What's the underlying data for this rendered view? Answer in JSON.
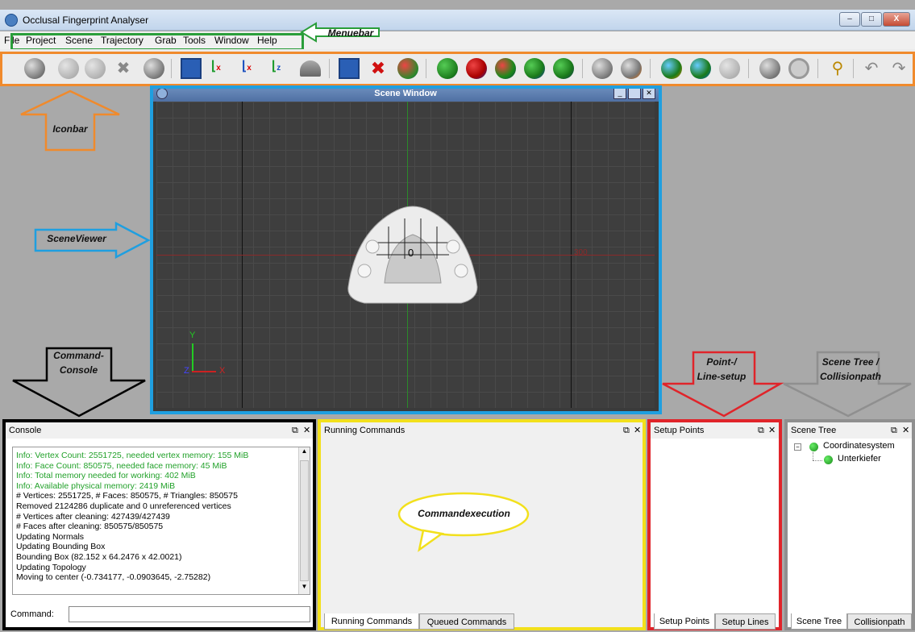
{
  "window": {
    "title": "Occlusal Fingerprint Analyser",
    "min": "–",
    "max": "□",
    "close": "X"
  },
  "menu": [
    "File",
    "Project",
    "Scene",
    "Trajectory",
    "Grab",
    "Tools",
    "Window",
    "Help"
  ],
  "scene": {
    "title": "Scene Window",
    "label_origin": "0",
    "label_300": "300",
    "axis_y": "Y",
    "axis_z": "Z",
    "axis_x": "X"
  },
  "annotations": {
    "menuebar": "Menuebar",
    "iconbar": "Iconbar",
    "sceneviewer": "SceneViewer",
    "console1": "Command-",
    "console2": "Console",
    "point1": "Point-/",
    "point2": "Line-setup",
    "tree1": "Scene Tree /",
    "tree2": "Collisionpath",
    "commandexecution": "Commandexecution"
  },
  "console": {
    "title": "Console",
    "command_label": "Command:",
    "lines": [
      {
        "text": "Info: Vertex Count: 2551725, needed vertex memory: 155 MiB",
        "color": "#22a12a"
      },
      {
        "text": "Info: Face Count: 850575, needed face memory: 45 MiB",
        "color": "#22a12a"
      },
      {
        "text": "Info: Total memory needed for working: 402 MiB",
        "color": "#22a12a"
      },
      {
        "text": "Info: Available physical memory: 2419 MiB",
        "color": "#22a12a"
      },
      {
        "text": "# Vertices: 2551725, # Faces: 850575, # Triangles: 850575",
        "color": "#000"
      },
      {
        "text": "Removed 2124286 duplicate and 0 unreferenced vertices",
        "color": "#000"
      },
      {
        "text": "# Vertices after cleaning: 427439/427439",
        "color": "#000"
      },
      {
        "text": "# Faces after cleaning: 850575/850575",
        "color": "#000"
      },
      {
        "text": "Updating Normals",
        "color": "#000"
      },
      {
        "text": "Updating Bounding Box",
        "color": "#000"
      },
      {
        "text": "Bounding Box (82.152 x 64.2476 x 42.0021)",
        "color": "#000"
      },
      {
        "text": "Updating Topology",
        "color": "#000"
      },
      {
        "text": "Moving to center (-0.734177, -0.0903645, -2.75282)",
        "color": "#000"
      }
    ]
  },
  "running": {
    "title": "Running Commands",
    "tab1": "Running Commands",
    "tab2": "Queued Commands"
  },
  "setup": {
    "title": "Setup Points",
    "tab1": "Setup Points",
    "tab2": "Setup Lines"
  },
  "tree": {
    "title": "Scene Tree",
    "root": "Coordinatesystem",
    "child": "Unterkiefer",
    "tab1": "Scene Tree",
    "tab2": "Collisionpath"
  },
  "dock_icons": {
    "float": "⧉",
    "close": "✕"
  }
}
